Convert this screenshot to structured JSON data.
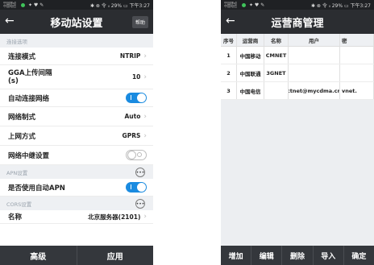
{
  "left": {
    "status": {
      "carrier": "中国移动 中国电信",
      "icons": "✱ ⊗ 令 ᵢₗ 29% ▭ 下午3:27"
    },
    "title": "移动站设置",
    "help_label": "帮助",
    "sections": {
      "connection": "连接选项",
      "apn": "APN设置",
      "cors": "CORS设置"
    },
    "rows": {
      "mode_label": "连接模式",
      "mode_value": "NTRIP",
      "gga_label": "GGA上传间隔\n(s)",
      "gga_value": "10",
      "auto_label": "自动连接网络",
      "net_label": "网络制式",
      "net_value": "Auto",
      "upnet_label": "上网方式",
      "upnet_value": "GPRS",
      "relay_label": "网络中继设置",
      "apn_label": "是否使用自动APN",
      "name_label": "名称",
      "name_value": "北京服务器(2101)"
    },
    "buttons": {
      "advanced": "高级",
      "apply": "应用"
    },
    "toggles": {
      "auto_connect": true,
      "relay": false,
      "auto_apn": true
    },
    "accent": "#1a8be0"
  },
  "right": {
    "status": {
      "carrier": "中国移动 中国电信",
      "icons": "✱ ⊗ 令 ᵢₗ 29% ▭ 下午3:27"
    },
    "title": "运营商管理",
    "columns": [
      "序号",
      "运营商",
      "名称",
      "用户",
      "密"
    ],
    "rows": [
      [
        "1",
        "中国移动",
        "CMNET",
        "",
        ""
      ],
      [
        "2",
        "中国联通",
        "3GNET",
        "",
        ""
      ],
      [
        "3",
        "中国电信",
        "",
        "ctnet@mycdma.cn",
        "vnet."
      ]
    ],
    "buttons": {
      "add": "增加",
      "edit": "编辑",
      "delete": "删除",
      "import": "导入",
      "confirm": "确定"
    }
  }
}
